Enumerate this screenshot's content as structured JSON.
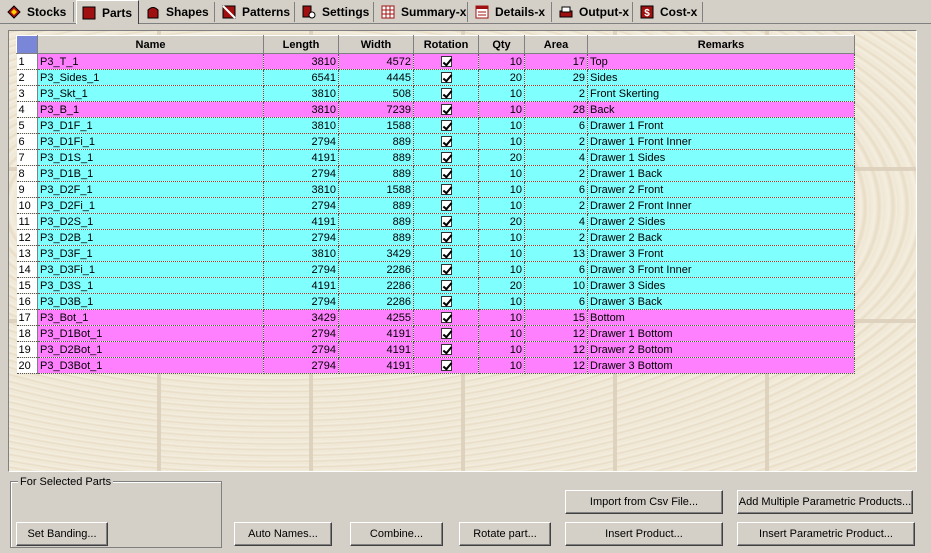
{
  "tabs": [
    {
      "label": "Stocks",
      "icon": "stocks-icon",
      "active": false
    },
    {
      "label": "Parts",
      "icon": "parts-icon",
      "active": true
    },
    {
      "label": "Shapes",
      "icon": "shapes-icon",
      "active": false
    },
    {
      "label": "Patterns",
      "icon": "patterns-icon",
      "active": false
    },
    {
      "label": "Settings",
      "icon": "settings-icon",
      "active": false
    },
    {
      "label": "Summary-x",
      "icon": "summary-icon",
      "active": false
    },
    {
      "label": "Details-x",
      "icon": "details-icon",
      "active": false
    },
    {
      "label": "Output-x",
      "icon": "output-icon",
      "active": false
    },
    {
      "label": "Cost-x",
      "icon": "cost-icon",
      "active": false
    }
  ],
  "grid": {
    "columns": [
      "Name",
      "Length",
      "Width",
      "Rotation",
      "Qty",
      "Area",
      "Remarks"
    ],
    "rows": [
      {
        "n": "1",
        "name": "P3_T_1",
        "length": "3810",
        "width": "4572",
        "rotation": true,
        "qty": "10",
        "area": "17",
        "remarks": "Top",
        "color": "pink"
      },
      {
        "n": "2",
        "name": "P3_Sides_1",
        "length": "6541",
        "width": "4445",
        "rotation": true,
        "qty": "20",
        "area": "29",
        "remarks": "Sides",
        "color": "cyan"
      },
      {
        "n": "3",
        "name": "P3_Skt_1",
        "length": "3810",
        "width": "508",
        "rotation": true,
        "qty": "10",
        "area": "2",
        "remarks": "Front Skerting",
        "color": "cyan"
      },
      {
        "n": "4",
        "name": "P3_B_1",
        "length": "3810",
        "width": "7239",
        "rotation": true,
        "qty": "10",
        "area": "28",
        "remarks": "Back",
        "color": "pink"
      },
      {
        "n": "5",
        "name": "P3_D1F_1",
        "length": "3810",
        "width": "1588",
        "rotation": true,
        "qty": "10",
        "area": "6",
        "remarks": "Drawer 1 Front",
        "color": "cyan"
      },
      {
        "n": "6",
        "name": "P3_D1Fi_1",
        "length": "2794",
        "width": "889",
        "rotation": true,
        "qty": "10",
        "area": "2",
        "remarks": "Drawer 1 Front Inner",
        "color": "cyan"
      },
      {
        "n": "7",
        "name": "P3_D1S_1",
        "length": "4191",
        "width": "889",
        "rotation": true,
        "qty": "20",
        "area": "4",
        "remarks": "Drawer 1 Sides",
        "color": "cyan"
      },
      {
        "n": "8",
        "name": "P3_D1B_1",
        "length": "2794",
        "width": "889",
        "rotation": true,
        "qty": "10",
        "area": "2",
        "remarks": "Drawer 1 Back",
        "color": "cyan"
      },
      {
        "n": "9",
        "name": "P3_D2F_1",
        "length": "3810",
        "width": "1588",
        "rotation": true,
        "qty": "10",
        "area": "6",
        "remarks": "Drawer 2 Front",
        "color": "cyan"
      },
      {
        "n": "10",
        "name": "P3_D2Fi_1",
        "length": "2794",
        "width": "889",
        "rotation": true,
        "qty": "10",
        "area": "2",
        "remarks": "Drawer 2 Front Inner",
        "color": "cyan"
      },
      {
        "n": "11",
        "name": "P3_D2S_1",
        "length": "4191",
        "width": "889",
        "rotation": true,
        "qty": "20",
        "area": "4",
        "remarks": "Drawer 2 Sides",
        "color": "cyan"
      },
      {
        "n": "12",
        "name": "P3_D2B_1",
        "length": "2794",
        "width": "889",
        "rotation": true,
        "qty": "10",
        "area": "2",
        "remarks": "Drawer 2 Back",
        "color": "cyan"
      },
      {
        "n": "13",
        "name": "P3_D3F_1",
        "length": "3810",
        "width": "3429",
        "rotation": true,
        "qty": "10",
        "area": "13",
        "remarks": "Drawer 3 Front",
        "color": "cyan"
      },
      {
        "n": "14",
        "name": "P3_D3Fi_1",
        "length": "2794",
        "width": "2286",
        "rotation": true,
        "qty": "10",
        "area": "6",
        "remarks": "Drawer 3 Front Inner",
        "color": "cyan"
      },
      {
        "n": "15",
        "name": "P3_D3S_1",
        "length": "4191",
        "width": "2286",
        "rotation": true,
        "qty": "20",
        "area": "10",
        "remarks": "Drawer 3 Sides",
        "color": "cyan"
      },
      {
        "n": "16",
        "name": "P3_D3B_1",
        "length": "2794",
        "width": "2286",
        "rotation": true,
        "qty": "10",
        "area": "6",
        "remarks": "Drawer 3 Back",
        "color": "cyan"
      },
      {
        "n": "17",
        "name": "P3_Bot_1",
        "length": "3429",
        "width": "4255",
        "rotation": true,
        "qty": "10",
        "area": "15",
        "remarks": "Bottom",
        "color": "pink"
      },
      {
        "n": "18",
        "name": "P3_D1Bot_1",
        "length": "2794",
        "width": "4191",
        "rotation": true,
        "qty": "10",
        "area": "12",
        "remarks": "Drawer 1 Bottom",
        "color": "pink"
      },
      {
        "n": "19",
        "name": "P3_D2Bot_1",
        "length": "2794",
        "width": "4191",
        "rotation": true,
        "qty": "10",
        "area": "12",
        "remarks": "Drawer 2 Bottom",
        "color": "pink"
      },
      {
        "n": "20",
        "name": "P3_D3Bot_1",
        "length": "2794",
        "width": "4191",
        "rotation": true,
        "qty": "10",
        "area": "12",
        "remarks": "Drawer 3 Bottom",
        "color": "pink"
      }
    ]
  },
  "selected_group": {
    "title": "For Selected Parts"
  },
  "buttons": {
    "set_banding": "Set Banding...",
    "auto_names": "Auto Names...",
    "combine": "Combine...",
    "rotate_part": "Rotate part...",
    "import_csv": "Import from Csv File...",
    "insert_product": "Insert Product...",
    "add_multiple_parametric": "Add Multiple Parametric Products...",
    "insert_parametric": "Insert Parametric Product..."
  },
  "colors": {
    "pink_row": "#ff80ff",
    "cyan_row": "#80ffff",
    "header_corner": "#7a86d8"
  }
}
